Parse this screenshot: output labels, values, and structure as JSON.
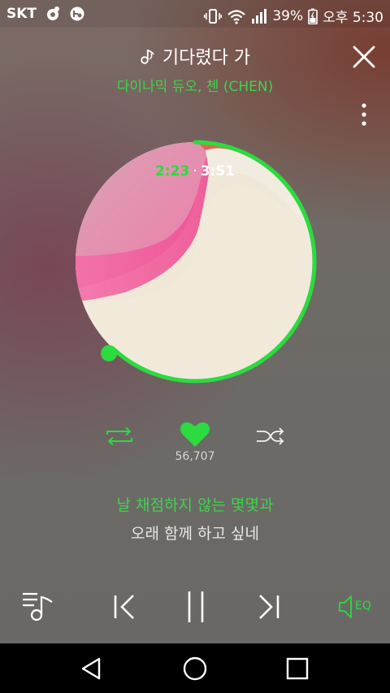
{
  "status_bar": {
    "carrier": "SKT",
    "battery": "39%",
    "time": "오후 5:30"
  },
  "header": {
    "title": "기다렸다 가",
    "artist": "다이나믹 듀오, 첸 (CHEN)"
  },
  "player": {
    "elapsed": "2:23",
    "separator": "·",
    "duration": "3:51",
    "progress": 0.619
  },
  "actions": {
    "like_count": "56,707"
  },
  "lyrics": {
    "current": "날 채점하지 않는 몇몇과",
    "next": "오래 함께 하고 싶네"
  },
  "controls": {
    "eq_label": "EQ"
  },
  "colors": {
    "accent": "#2bdb3f",
    "text": "#ffffff"
  }
}
